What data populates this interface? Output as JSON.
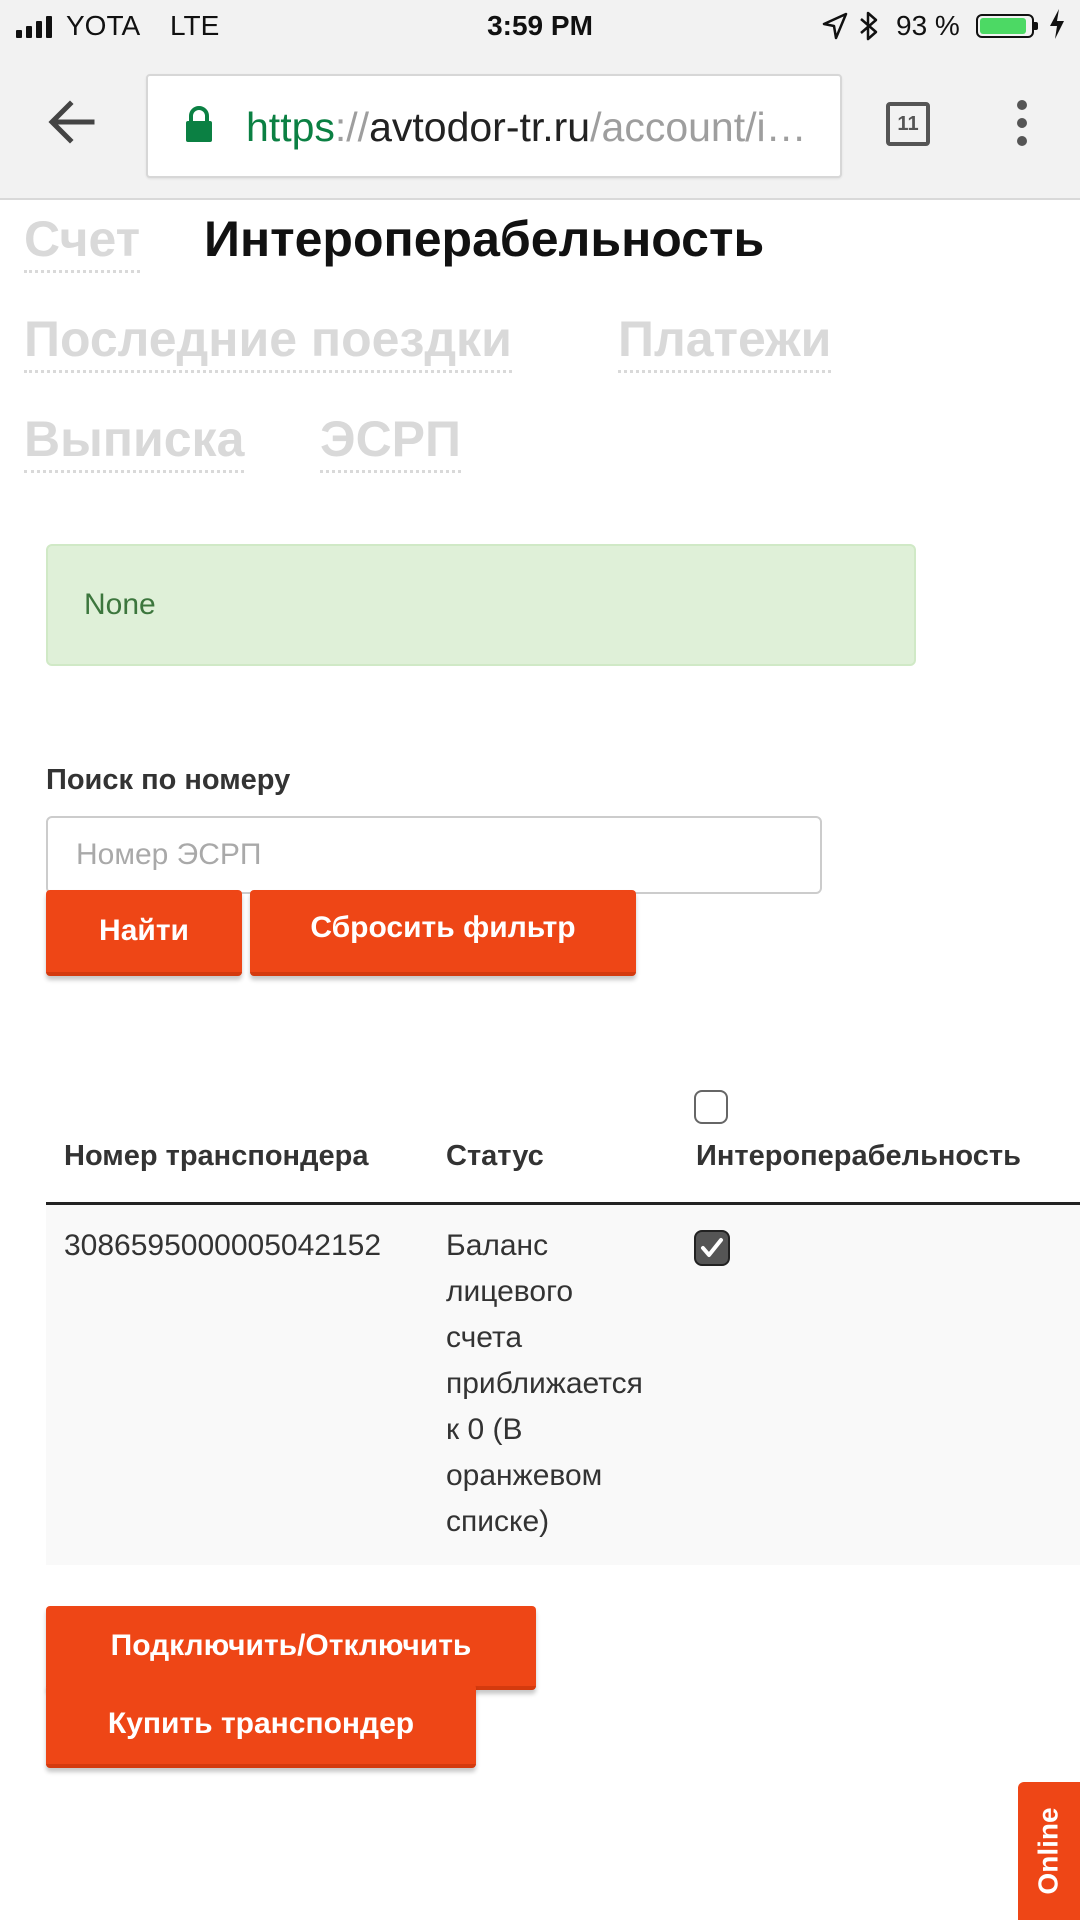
{
  "status_bar": {
    "carrier": "YOTA",
    "network": "LTE",
    "time": "3:59 PM",
    "battery_percent": "93 %",
    "battery_level": 0.93,
    "battery_color": "#4cd964",
    "icons": [
      "signal-icon",
      "location-arrow-icon",
      "bluetooth-icon",
      "battery-icon",
      "charging-bolt-icon"
    ]
  },
  "browser": {
    "url_scheme": "https",
    "url_separator": "://",
    "url_host": "avtodor-tr.ru",
    "url_path": "/account/i…",
    "tab_count": "11",
    "icons": [
      "back-arrow-icon",
      "lock-icon",
      "tab-switcher-icon",
      "overflow-menu-icon"
    ]
  },
  "nav": {
    "tabs": [
      {
        "label": "Счет",
        "active": false
      },
      {
        "label": "Интероперабельность",
        "active": true
      },
      {
        "label": "Последние поездки",
        "active": false
      },
      {
        "label": "Платежи",
        "active": false
      },
      {
        "label": "Выписка",
        "active": false
      },
      {
        "label": "ЭСРП",
        "active": false
      }
    ]
  },
  "alert": {
    "text": "None",
    "bg_color": "#dff0d8",
    "text_color": "#3c763d"
  },
  "search": {
    "label": "Поиск по номеру",
    "placeholder": "Номер ЭСРП",
    "value": "",
    "find_button": "Найти",
    "reset_button": "Сбросить фильтр"
  },
  "table": {
    "columns": [
      "Номер транспондера",
      "Статус",
      "Интероперабельность"
    ],
    "select_all_checked": false,
    "rows": [
      {
        "transponder": "308659500000504215​2",
        "status_lines": [
          "Баланс",
          "лицевого",
          "счета",
          "приближается",
          "к 0 (В",
          "оранжевом",
          "списке)"
        ],
        "interoperable": true
      }
    ]
  },
  "actions": {
    "toggle_button": "Подключить/Отключить",
    "buy_button": "Купить транспондер"
  },
  "online_tab": {
    "label": "Online"
  },
  "colors": {
    "accent": "#ee4616",
    "inactive_tab": "#d9d9d9"
  }
}
